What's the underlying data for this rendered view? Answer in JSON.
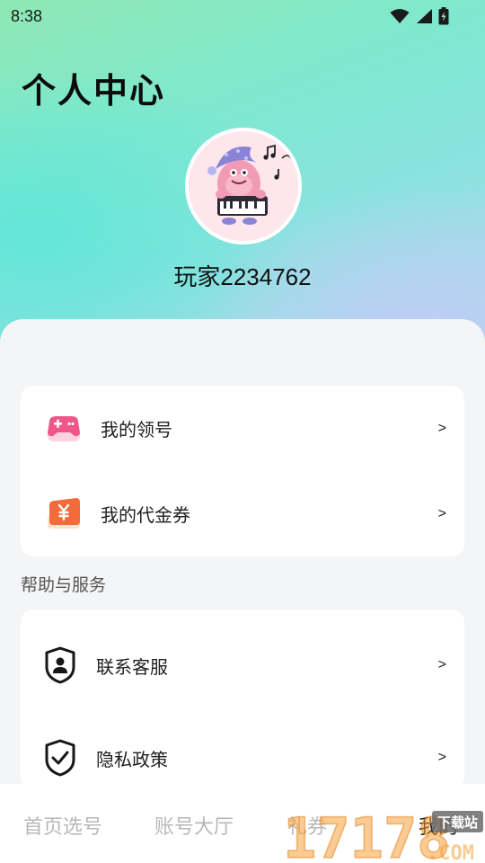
{
  "status_bar": {
    "time": "8:38",
    "icons": [
      "wifi-icon",
      "signal-icon",
      "battery-charging-icon"
    ]
  },
  "header": {
    "title": "个人中心"
  },
  "profile": {
    "avatar": "pink-piano-monster-avatar",
    "username": "玩家2234762"
  },
  "menu_main": [
    {
      "label": "我的领号",
      "icon": "gamepad-icon",
      "arrow": ">"
    },
    {
      "label": "我的代金券",
      "icon": "voucher-icon",
      "arrow": ">"
    }
  ],
  "help_section": {
    "title": "帮助与服务",
    "items": [
      {
        "label": "联系客服",
        "icon": "customer-service-shield-icon",
        "arrow": ">"
      },
      {
        "label": "隐私政策",
        "icon": "privacy-shield-check-icon",
        "arrow": ">"
      }
    ]
  },
  "tabbar": {
    "tabs": [
      {
        "label": "首页选号",
        "active": false
      },
      {
        "label": "账号大厅",
        "active": false
      },
      {
        "label": "礼券",
        "active": false
      },
      {
        "label": "我的",
        "active": true
      }
    ]
  },
  "watermark": {
    "text": "17178",
    "suffix": ".COM",
    "badge": "下载站"
  },
  "colors": {
    "accent_pink": "#f0568a",
    "voucher_orange": "#f26b3a",
    "inactive_tab": "#b8b8b8"
  }
}
